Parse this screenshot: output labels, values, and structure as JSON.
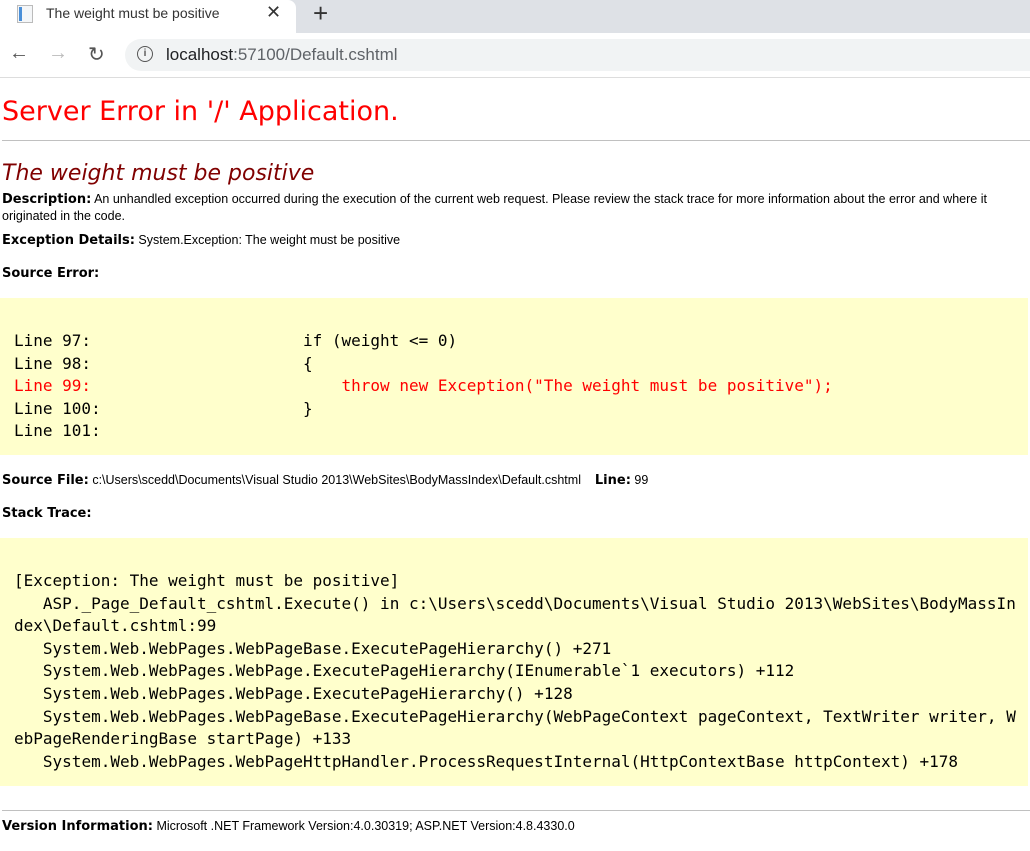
{
  "browser": {
    "tab_title": "The weight must be positive",
    "tab_close": "✕",
    "new_tab": "+",
    "back": "←",
    "forward": "→",
    "reload": "↻",
    "url_host": "localhost",
    "url_path": ":57100/Default.cshtml"
  },
  "page": {
    "heading": "Server Error in '/' Application.",
    "error_title": "The weight must be positive",
    "description_label": "Description:",
    "description": "An unhandled exception occurred during the execution of the current web request. Please review the stack trace for more information about the error and where it originated in the code.",
    "exception_label": "Exception Details:",
    "exception": "System.Exception: The weight must be positive",
    "source_error_label": "Source Error:",
    "source_lines": [
      {
        "text": "Line 97:                      if (weight <= 0)",
        "error": false
      },
      {
        "text": "Line 98:                      {",
        "error": false
      },
      {
        "text": "Line 99:                          throw new Exception(\"The weight must be positive\");",
        "error": true
      },
      {
        "text": "Line 100:                     }",
        "error": false
      },
      {
        "text": "Line 101:",
        "error": false
      }
    ],
    "source_file_label": "Source File:",
    "source_file": "c:\\Users\\scedd\\Documents\\Visual Studio 2013\\WebSites\\BodyMassIndex\\Default.cshtml",
    "line_label": "Line:",
    "line_number": "99",
    "stack_trace_label": "Stack Trace:",
    "stack_lines": [
      "[Exception: The weight must be positive]",
      "   ASP._Page_Default_cshtml.Execute() in c:\\Users\\scedd\\Documents\\Visual Studio 2013\\WebSites\\BodyMassIndex\\Default.cshtml:99",
      "   System.Web.WebPages.WebPageBase.ExecutePageHierarchy() +271",
      "   System.Web.WebPages.WebPage.ExecutePageHierarchy(IEnumerable`1 executors) +112",
      "   System.Web.WebPages.WebPage.ExecutePageHierarchy() +128",
      "   System.Web.WebPages.WebPageBase.ExecutePageHierarchy(WebPageContext pageContext, TextWriter writer, WebPageRenderingBase startPage) +133",
      "   System.Web.WebPages.WebPageHttpHandler.ProcessRequestInternal(HttpContextBase httpContext) +178"
    ],
    "version_label": "Version Information:",
    "version": "Microsoft .NET Framework Version:4.0.30319; ASP.NET Version:4.8.4330.0"
  },
  "colors": {
    "heading": "#ff0000",
    "error_title": "#800000",
    "code_bg": "#ffffcc",
    "error_line": "#ff0000"
  }
}
